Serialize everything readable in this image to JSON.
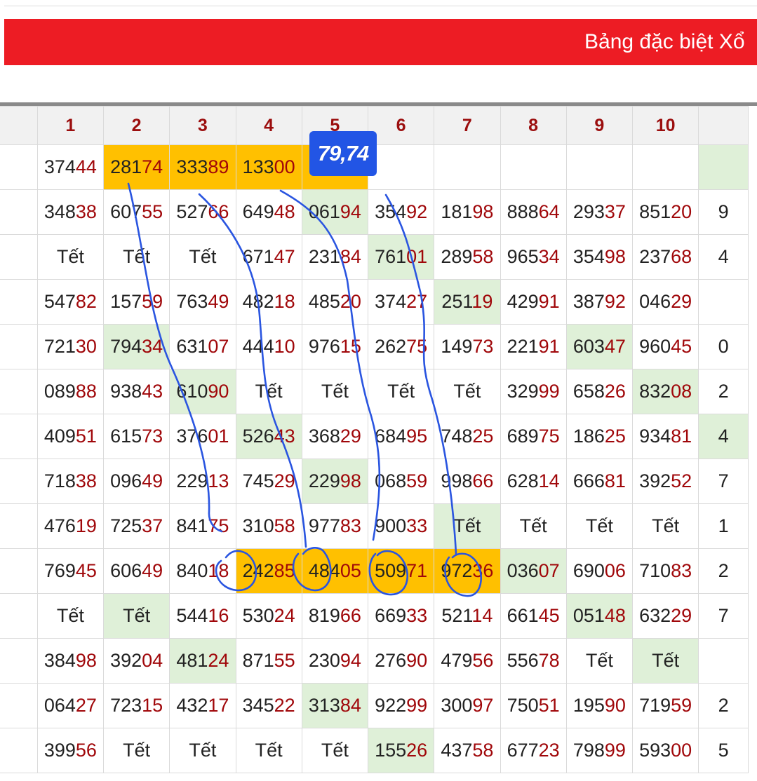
{
  "banner": {
    "title": "Bảng đặc biệt Xổ"
  },
  "annotation": {
    "tag": "79,74"
  },
  "colors": {
    "banner": "#ed1c24",
    "highlight": "#ffc000",
    "match": "#dff0d8",
    "ink": "#2a55e0"
  },
  "header": [
    "",
    "1",
    "2",
    "3",
    "4",
    "5",
    "6",
    "7",
    "8",
    "9",
    "10",
    ""
  ],
  "rows": [
    [
      [
        "",
        ""
      ],
      [
        "374",
        "44"
      ],
      [
        "281",
        "74",
        "o"
      ],
      [
        "333",
        "89",
        "o"
      ],
      [
        "133",
        "00",
        "o"
      ],
      [
        "",
        "",
        "o"
      ],
      [
        "",
        ""
      ],
      [
        "",
        ""
      ],
      [
        "",
        ""
      ],
      [
        "",
        ""
      ],
      [
        "",
        ""
      ],
      [
        "",
        "",
        "g"
      ]
    ],
    [
      [
        "",
        ""
      ],
      [
        "348",
        "38"
      ],
      [
        "607",
        "55"
      ],
      [
        "527",
        "66"
      ],
      [
        "649",
        "48"
      ],
      [
        "061",
        "94",
        "g"
      ],
      [
        "354",
        "92"
      ],
      [
        "181",
        "98"
      ],
      [
        "888",
        "64"
      ],
      [
        "293",
        "37"
      ],
      [
        "851",
        "20"
      ],
      [
        "9",
        ""
      ]
    ],
    [
      [
        "",
        ""
      ],
      [
        "Tết",
        ""
      ],
      [
        "Tết",
        ""
      ],
      [
        "Tết",
        ""
      ],
      [
        "671",
        "47"
      ],
      [
        "231",
        "84"
      ],
      [
        "761",
        "01",
        "g"
      ],
      [
        "289",
        "58"
      ],
      [
        "965",
        "34"
      ],
      [
        "354",
        "98"
      ],
      [
        "237",
        "68"
      ],
      [
        "4",
        ""
      ]
    ],
    [
      [
        "",
        ""
      ],
      [
        "547",
        "82"
      ],
      [
        "157",
        "59"
      ],
      [
        "763",
        "49"
      ],
      [
        "482",
        "18"
      ],
      [
        "485",
        "20"
      ],
      [
        "374",
        "27"
      ],
      [
        "251",
        "19",
        "g"
      ],
      [
        "429",
        "91"
      ],
      [
        "387",
        "92"
      ],
      [
        "046",
        "29"
      ],
      [
        "",
        ""
      ]
    ],
    [
      [
        "",
        ""
      ],
      [
        "721",
        "30"
      ],
      [
        "794",
        "34",
        "g"
      ],
      [
        "631",
        "07"
      ],
      [
        "444",
        "10"
      ],
      [
        "976",
        "15"
      ],
      [
        "262",
        "75"
      ],
      [
        "149",
        "73"
      ],
      [
        "221",
        "91"
      ],
      [
        "603",
        "47",
        "g"
      ],
      [
        "960",
        "45"
      ],
      [
        "0",
        ""
      ]
    ],
    [
      [
        "",
        ""
      ],
      [
        "089",
        "88"
      ],
      [
        "938",
        "43"
      ],
      [
        "610",
        "90",
        "g"
      ],
      [
        "Tết",
        ""
      ],
      [
        "Tết",
        ""
      ],
      [
        "Tết",
        ""
      ],
      [
        "Tết",
        ""
      ],
      [
        "329",
        "99"
      ],
      [
        "658",
        "26"
      ],
      [
        "832",
        "08",
        "g"
      ],
      [
        "2",
        ""
      ]
    ],
    [
      [
        "",
        ""
      ],
      [
        "409",
        "51"
      ],
      [
        "615",
        "73"
      ],
      [
        "376",
        "01"
      ],
      [
        "526",
        "43",
        "g"
      ],
      [
        "368",
        "29"
      ],
      [
        "684",
        "95"
      ],
      [
        "748",
        "25"
      ],
      [
        "689",
        "75"
      ],
      [
        "186",
        "25"
      ],
      [
        "934",
        "81"
      ],
      [
        "4",
        "",
        "g"
      ]
    ],
    [
      [
        "",
        ""
      ],
      [
        "718",
        "38"
      ],
      [
        "096",
        "49"
      ],
      [
        "229",
        "13"
      ],
      [
        "745",
        "29"
      ],
      [
        "229",
        "98",
        "g"
      ],
      [
        "068",
        "59"
      ],
      [
        "998",
        "66"
      ],
      [
        "628",
        "14"
      ],
      [
        "666",
        "81"
      ],
      [
        "392",
        "52"
      ],
      [
        "7",
        ""
      ]
    ],
    [
      [
        "",
        ""
      ],
      [
        "476",
        "19"
      ],
      [
        "725",
        "37"
      ],
      [
        "841",
        "75"
      ],
      [
        "310",
        "58"
      ],
      [
        "977",
        "83"
      ],
      [
        "900",
        "33"
      ],
      [
        "Tết",
        "",
        "g"
      ],
      [
        "Tết",
        ""
      ],
      [
        "Tết",
        ""
      ],
      [
        "Tết",
        ""
      ],
      [
        "1",
        ""
      ]
    ],
    [
      [
        "",
        ""
      ],
      [
        "769",
        "45"
      ],
      [
        "606",
        "49"
      ],
      [
        "840",
        "18"
      ],
      [
        "242",
        "85",
        "o"
      ],
      [
        "484",
        "05",
        "o"
      ],
      [
        "509",
        "71",
        "o"
      ],
      [
        "972",
        "36",
        "o"
      ],
      [
        "036",
        "07",
        "g"
      ],
      [
        "690",
        "06"
      ],
      [
        "710",
        "83"
      ],
      [
        "2",
        ""
      ]
    ],
    [
      [
        "",
        ""
      ],
      [
        "Tết",
        ""
      ],
      [
        "Tết",
        "",
        "g"
      ],
      [
        "544",
        "16"
      ],
      [
        "530",
        "24"
      ],
      [
        "819",
        "66"
      ],
      [
        "669",
        "33"
      ],
      [
        "521",
        "14"
      ],
      [
        "661",
        "45"
      ],
      [
        "051",
        "48",
        "g"
      ],
      [
        "632",
        "29"
      ],
      [
        "7",
        ""
      ]
    ],
    [
      [
        "",
        ""
      ],
      [
        "384",
        "98"
      ],
      [
        "392",
        "04"
      ],
      [
        "481",
        "24",
        "g"
      ],
      [
        "871",
        "55"
      ],
      [
        "230",
        "94"
      ],
      [
        "276",
        "90"
      ],
      [
        "479",
        "56"
      ],
      [
        "556",
        "78"
      ],
      [
        "Tết",
        ""
      ],
      [
        "Tết",
        "",
        "g"
      ],
      [
        "",
        ""
      ]
    ],
    [
      [
        "",
        ""
      ],
      [
        "064",
        "27"
      ],
      [
        "723",
        "15"
      ],
      [
        "432",
        "17"
      ],
      [
        "345",
        "22"
      ],
      [
        "313",
        "84",
        "g"
      ],
      [
        "922",
        "99"
      ],
      [
        "300",
        "97"
      ],
      [
        "750",
        "51"
      ],
      [
        "195",
        "90"
      ],
      [
        "719",
        "59"
      ],
      [
        "2",
        ""
      ]
    ],
    [
      [
        "",
        ""
      ],
      [
        "399",
        "56"
      ],
      [
        "Tết",
        ""
      ],
      [
        "Tết",
        ""
      ],
      [
        "Tết",
        ""
      ],
      [
        "Tết",
        ""
      ],
      [
        "155",
        "26",
        "g"
      ],
      [
        "437",
        "58"
      ],
      [
        "677",
        "23"
      ],
      [
        "798",
        "99"
      ],
      [
        "593",
        "00"
      ],
      [
        "5",
        ""
      ]
    ]
  ]
}
